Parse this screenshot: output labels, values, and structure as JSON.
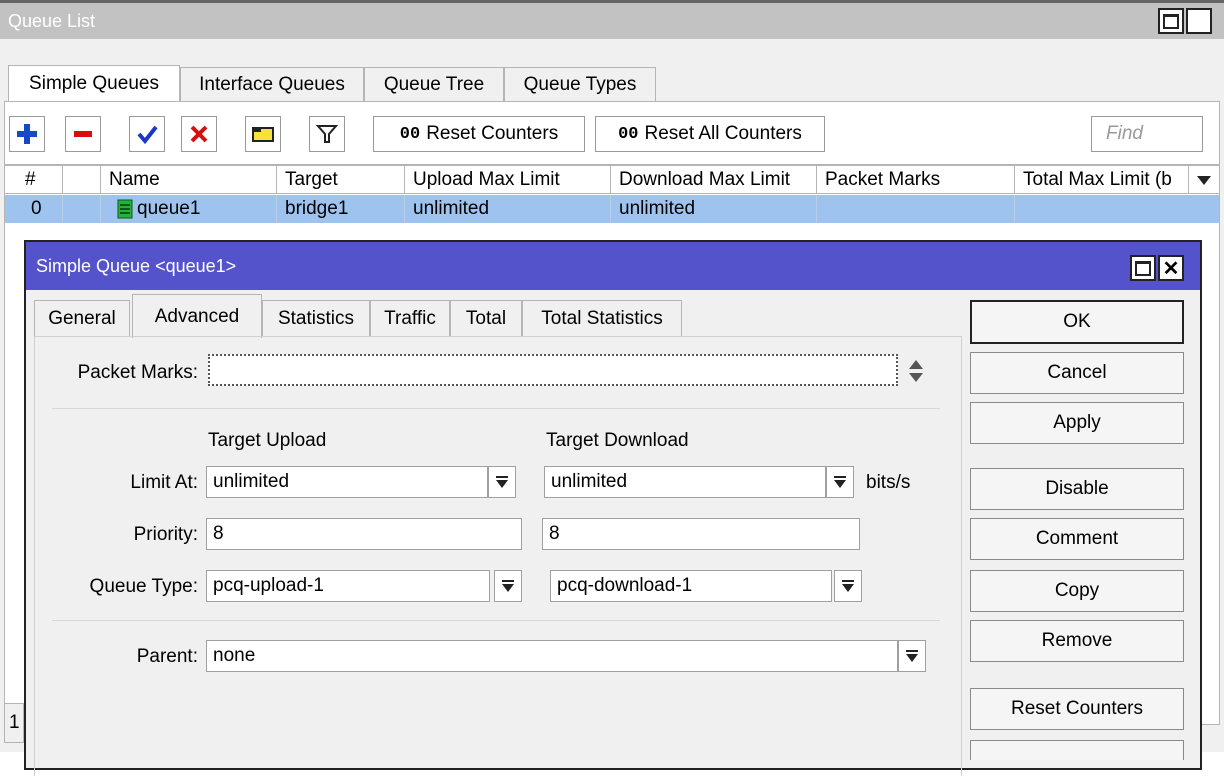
{
  "queue_list": {
    "title": "Queue List",
    "tabs": [
      "Simple Queues",
      "Interface Queues",
      "Queue Tree",
      "Queue Types"
    ],
    "toolbar": {
      "reset_counters": "Reset Counters",
      "reset_all_counters": "Reset All Counters",
      "find_placeholder": "Find",
      "counter_glyph": "00"
    },
    "columns": [
      "#",
      "Name",
      "Target",
      "Upload Max Limit",
      "Download Max Limit",
      "Packet Marks",
      "Total Max Limit (b"
    ],
    "rows": [
      {
        "index": "0",
        "name": "queue1",
        "target": "bridge1",
        "upload_max": "unlimited",
        "download_max": "unlimited",
        "packet_marks": "",
        "total_max": ""
      }
    ],
    "status_fragment": "1",
    "selection_color": "#9ec3ef"
  },
  "dialog": {
    "title": "Simple Queue <queue1>",
    "titlebar_color": "#5553cc",
    "tabs": [
      "General",
      "Advanced",
      "Statistics",
      "Traffic",
      "Total",
      "Total Statistics"
    ],
    "active_tab": "Advanced",
    "packet_marks_label": "Packet Marks:",
    "target_upload_header": "Target Upload",
    "target_download_header": "Target Download",
    "limit_at": {
      "label": "Limit At:",
      "upload": "unlimited",
      "download": "unlimited",
      "unit": "bits/s"
    },
    "priority": {
      "label": "Priority:",
      "upload": "8",
      "download": "8"
    },
    "queue_type": {
      "label": "Queue Type:",
      "upload": "pcq-upload-1",
      "download": "pcq-download-1"
    },
    "parent": {
      "label": "Parent:",
      "value": "none"
    },
    "buttons": [
      "OK",
      "Cancel",
      "Apply",
      "Disable",
      "Comment",
      "Copy",
      "Remove",
      "Reset Counters"
    ]
  }
}
